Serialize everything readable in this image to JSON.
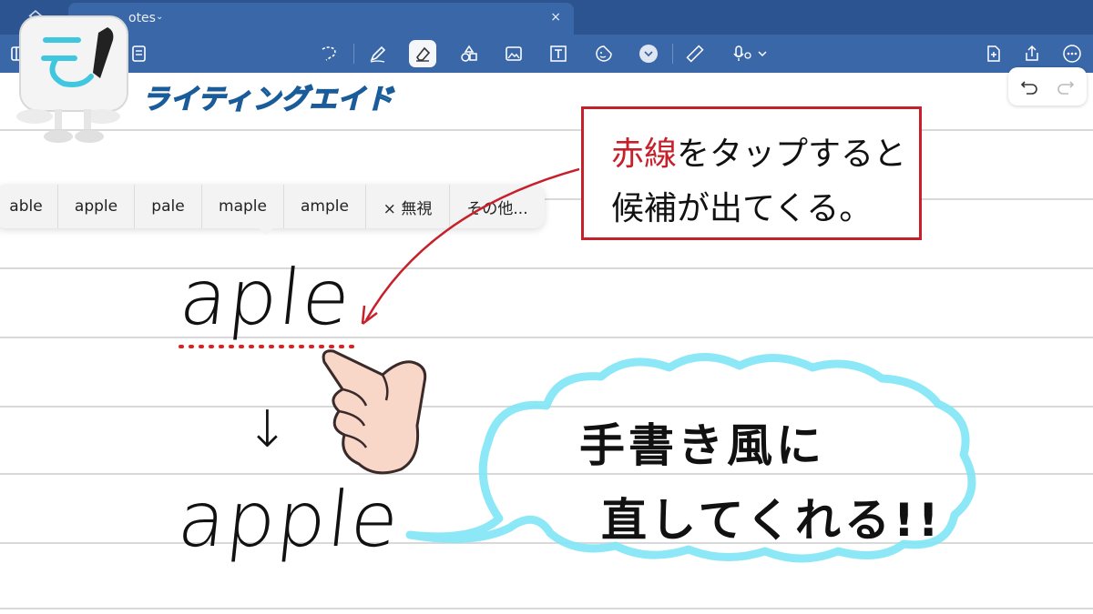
{
  "tab": {
    "title": "otes",
    "close": "×",
    "chevron": "⌄"
  },
  "brand": {
    "name": "ライティングエイド"
  },
  "suggestions": [
    "able",
    "apple",
    "pale",
    "maple",
    "ample",
    "× 無視",
    "その他..."
  ],
  "callout": {
    "red_word": "赤線",
    "line1_rest": "をタップすると",
    "line2": "候補が出てくる。"
  },
  "handwriting": {
    "misspelled": "aple",
    "arrow": "↓",
    "corrected": "apple"
  },
  "cloud": {
    "line1": "手書き風に",
    "line2": "直してくれる!!"
  },
  "colors": {
    "toolbar": "#3a67a8",
    "tabbar": "#2c5490",
    "callout_border": "#c7202b",
    "cloud": "#7fe6f5",
    "brand": "#3fc7e0"
  },
  "icons": [
    "home-icon",
    "sidebar-icon",
    "lasso-icon",
    "pen-icon",
    "eraser-icon",
    "shapes-icon",
    "image-icon",
    "textbox-icon",
    "sticker-icon",
    "color-chevron-icon",
    "ruler-icon",
    "mic-icon",
    "add-page-icon",
    "share-icon",
    "more-icon",
    "undo-icon",
    "redo-icon",
    "pointing-hand-icon"
  ]
}
